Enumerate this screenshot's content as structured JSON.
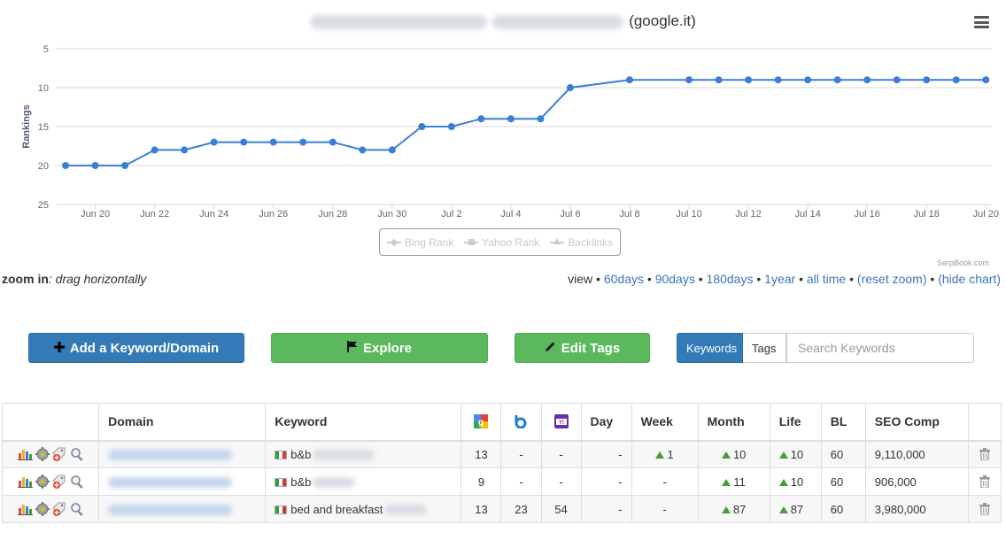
{
  "chart": {
    "title_suffix": "(google.it)",
    "credit": "SerpBook.com"
  },
  "chart_data": {
    "type": "line",
    "title": "(google.it)",
    "ylabel": "Rankings",
    "xlabel": "",
    "y_reversed": true,
    "ylim": [
      5,
      25
    ],
    "y_ticks": [
      "5",
      "10",
      "15",
      "20",
      "25"
    ],
    "x_ticks": [
      "Jun 20",
      "Jun 22",
      "Jun 24",
      "Jun 26",
      "Jun 28",
      "Jun 30",
      "Jul 2",
      "Jul 4",
      "Jul 6",
      "Jul 8",
      "Jul 10",
      "Jul 12",
      "Jul 14",
      "Jul 16",
      "Jul 18",
      "Jul 20"
    ],
    "x_start": "Jun 19",
    "x_end": "Jul 20",
    "grid": true,
    "series": [
      {
        "name": "Google",
        "color": "#3a7fd5",
        "points": [
          [
            "Jun 19",
            20
          ],
          [
            "Jun 20",
            20
          ],
          [
            "Jun 21",
            20
          ],
          [
            "Jun 22",
            18
          ],
          [
            "Jun 23",
            18
          ],
          [
            "Jun 24",
            17
          ],
          [
            "Jun 25",
            17
          ],
          [
            "Jun 26",
            17
          ],
          [
            "Jun 27",
            17
          ],
          [
            "Jun 28",
            17
          ],
          [
            "Jun 29",
            18
          ],
          [
            "Jun 30",
            18
          ],
          [
            "Jul 1",
            15
          ],
          [
            "Jul 2",
            15
          ],
          [
            "Jul 3",
            14
          ],
          [
            "Jul 4",
            14
          ],
          [
            "Jul 5",
            14
          ],
          [
            "Jul 6",
            10
          ],
          [
            "Jul 8",
            9
          ],
          [
            "Jul 10",
            9
          ],
          [
            "Jul 11",
            9
          ],
          [
            "Jul 12",
            9
          ],
          [
            "Jul 13",
            9
          ],
          [
            "Jul 14",
            9
          ],
          [
            "Jul 15",
            9
          ],
          [
            "Jul 16",
            9
          ],
          [
            "Jul 17",
            9
          ],
          [
            "Jul 18",
            9
          ],
          [
            "Jul 19",
            9
          ],
          [
            "Jul 20",
            9
          ]
        ]
      }
    ],
    "legend": {
      "placement": "bottom-center",
      "hidden_entries": [
        "Bing Rank",
        "Yahoo Rank",
        "Backlinks"
      ]
    }
  },
  "legend": {
    "bing": "Bing Rank",
    "yahoo": "Yahoo Rank",
    "backlinks": "Backlinks"
  },
  "zoom": {
    "label": "zoom in",
    "hint": ": drag horizontally"
  },
  "view": {
    "label": "view",
    "sep": "•",
    "days60": "60days",
    "days90": "90days",
    "days180": "180days",
    "year1": "1year",
    "all": "all time",
    "reset": "(reset zoom)",
    "hide": "(hide chart)"
  },
  "toolbar": {
    "add_label": "Add a Keyword/Domain",
    "explore_label": "Explore",
    "edit_tags_label": "Edit Tags",
    "keywords_tab": "Keywords",
    "tags_tab": "Tags",
    "search_placeholder": "Search Keywords"
  },
  "table": {
    "headers": {
      "domain": "Domain",
      "keyword": "Keyword",
      "day": "Day",
      "week": "Week",
      "month": "Month",
      "life": "Life",
      "bl": "BL",
      "seo": "SEO Comp"
    },
    "rows": [
      {
        "keyword": "b&b",
        "google": "13",
        "bing": "-",
        "yahoo": "-",
        "day": "-",
        "week": "1",
        "month": "10",
        "life": "10",
        "bl": "60",
        "seo": "9,110,000"
      },
      {
        "keyword": "b&b",
        "google": "9",
        "bing": "-",
        "yahoo": "-",
        "day": "-",
        "week": "-",
        "month": "11",
        "life": "10",
        "bl": "60",
        "seo": "906,000"
      },
      {
        "keyword": "bed and breakfast",
        "google": "13",
        "bing": "23",
        "yahoo": "54",
        "day": "-",
        "week": "-",
        "month": "87",
        "life": "87",
        "bl": "60",
        "seo": "3,980,000"
      }
    ]
  }
}
